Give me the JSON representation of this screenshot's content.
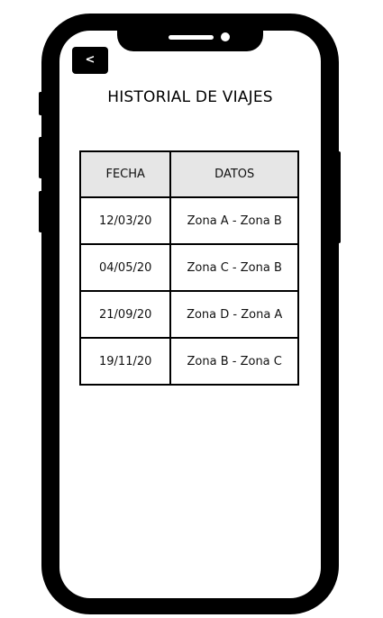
{
  "navigation": {
    "back_label": "<"
  },
  "page": {
    "title": "HISTORIAL DE VIAJES"
  },
  "table": {
    "headers": [
      "FECHA",
      "DATOS"
    ],
    "rows": [
      {
        "fecha": "12/03/20",
        "datos": "Zona A - Zona B"
      },
      {
        "fecha": "04/05/20",
        "datos": "Zona C - Zona B"
      },
      {
        "fecha": "21/09/20",
        "datos": "Zona D - Zona A"
      },
      {
        "fecha": "19/11/20",
        "datos": "Zona B - Zona C"
      }
    ]
  },
  "colors": {
    "frame": "#000000",
    "screen": "#ffffff",
    "header_bg": "#e6e6e6",
    "button_bg": "#000000",
    "button_text": "#ffffff"
  }
}
